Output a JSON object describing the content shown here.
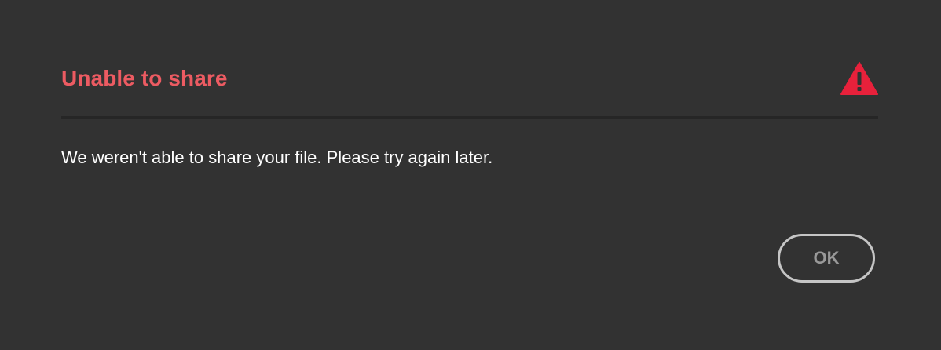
{
  "dialog": {
    "title": "Unable to share",
    "message": "We weren't able to share your file. Please try again later.",
    "icon": "warning-icon",
    "ok_label": "OK"
  },
  "colors": {
    "background": "#323232",
    "title": "#ec5b62",
    "warning": "#e8213b",
    "message": "#ffffff",
    "button_border": "#c5c5c5",
    "button_text": "#999999"
  }
}
